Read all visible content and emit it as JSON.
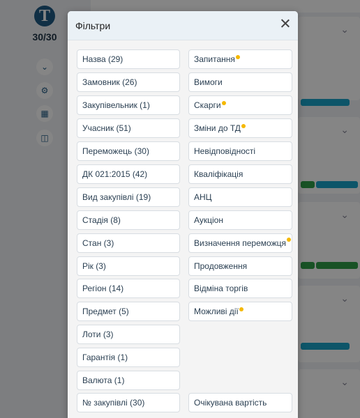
{
  "background": {
    "counter": "30/30"
  },
  "modal": {
    "title": "Фільтри"
  },
  "filters_left": [
    {
      "label": "Назва (29)"
    },
    {
      "label": "Замовник (26)"
    },
    {
      "label": "Закупівельник (1)"
    },
    {
      "label": "Учасник (51)"
    },
    {
      "label": "Переможець (30)"
    },
    {
      "label": "ДК 021:2015 (42)"
    },
    {
      "label": "Вид закупівлі (19)"
    },
    {
      "label": "Стадія (8)"
    },
    {
      "label": "Стан (3)"
    },
    {
      "label": "Рік (3)"
    },
    {
      "label": "Регіон (14)"
    },
    {
      "label": "Предмет (5)"
    },
    {
      "label": "Лоти (3)"
    },
    {
      "label": "Гарантія (1)"
    },
    {
      "label": "Валюта (1)"
    },
    {
      "label": "№ закупівлі (30)"
    }
  ],
  "filters_right": [
    {
      "label": "Запитання"
    },
    {
      "label": "Вимоги"
    },
    {
      "label": "Скарги"
    },
    {
      "label": "Зміни до ТД"
    },
    {
      "label": "Невідповідності"
    },
    {
      "label": "Кваліфікація"
    },
    {
      "label": "АНЦ"
    },
    {
      "label": "Аукціон"
    },
    {
      "label": "Визначення переможця"
    },
    {
      "label": "Продовження"
    },
    {
      "label": "Відміна торгів"
    },
    {
      "label": "Можливі дії"
    },
    {
      "label": "Очікувана вартість"
    }
  ],
  "colors": {
    "indicator_dot": "#f5b800",
    "logo": "#1f5a85",
    "tag_blue": "#1aa3c9",
    "tag_green": "#2e9e48"
  }
}
